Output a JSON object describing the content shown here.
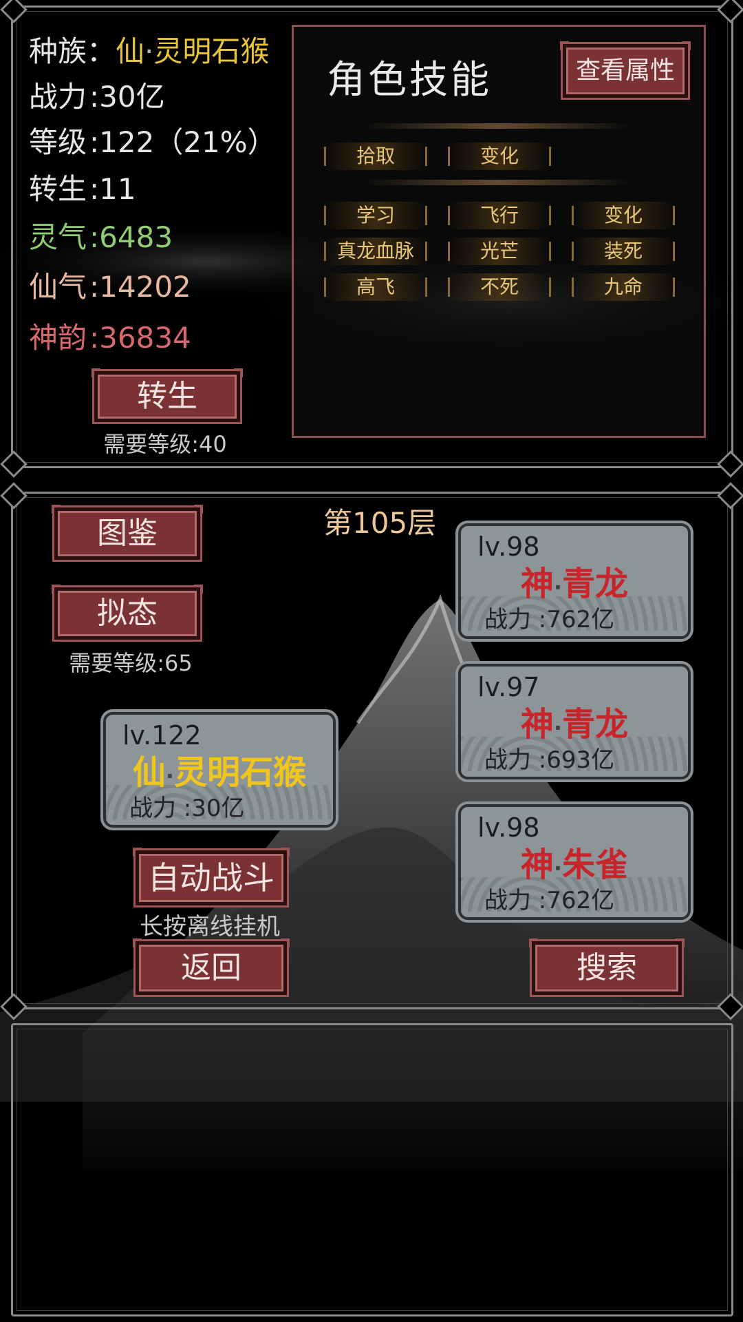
{
  "player": {
    "race_label": "种族：",
    "race_prefix": "仙",
    "race_sep": "·",
    "race_name": "灵明石猴",
    "power_label": "战力",
    "power_value": ":30亿",
    "level_label": "等级",
    "level_value": ":122（21%）",
    "rebirth_label": "转生",
    "rebirth_value": ":11",
    "lingqi_label": "灵气",
    "lingqi_value": ":6483",
    "xianqi_label": "仙气",
    "xianqi_value": ":14202",
    "shenyun_label": "神韵",
    "shenyun_value": ":36834",
    "rebirth_button": "转生",
    "rebirth_requirement": "需要等级:40"
  },
  "skills_panel": {
    "title": "角色技能",
    "view_attributes_button": "查看属性",
    "row1": [
      "拾取",
      "变化"
    ],
    "rows": [
      [
        "学习",
        "飞行",
        "变化"
      ],
      [
        "真龙血脉",
        "光芒",
        "装死"
      ],
      [
        "高飞",
        "不死",
        "九命"
      ]
    ]
  },
  "battle": {
    "floor": "第105层",
    "codex_button": "图鉴",
    "mimic_button": "拟态",
    "mimic_requirement": "需要等级:65",
    "self_card": {
      "level": "lv.122",
      "prefix": "仙",
      "sep": "·",
      "name": "灵明石猴",
      "power": "战力 :30亿"
    },
    "enemies": [
      {
        "level": "lv.98",
        "prefix": "神",
        "sep": "·",
        "name": "青龙",
        "power": "战力 :762亿"
      },
      {
        "level": "lv.97",
        "prefix": "神",
        "sep": "·",
        "name": "青龙",
        "power": "战力 :693亿"
      },
      {
        "level": "lv.98",
        "prefix": "神",
        "sep": "·",
        "name": "朱雀",
        "power": "战力 :762亿"
      }
    ],
    "auto_battle_button": "自动战斗",
    "auto_battle_hint": "长按离线挂机",
    "back_button": "返回",
    "search_button": "搜索"
  },
  "colors": {
    "gold": "#e8c43a",
    "green": "#8fce72",
    "peach": "#e8b9a0",
    "shenyun": "#d8686c",
    "enemy_red": "#c8252a",
    "floor_text": "#eec79a"
  }
}
